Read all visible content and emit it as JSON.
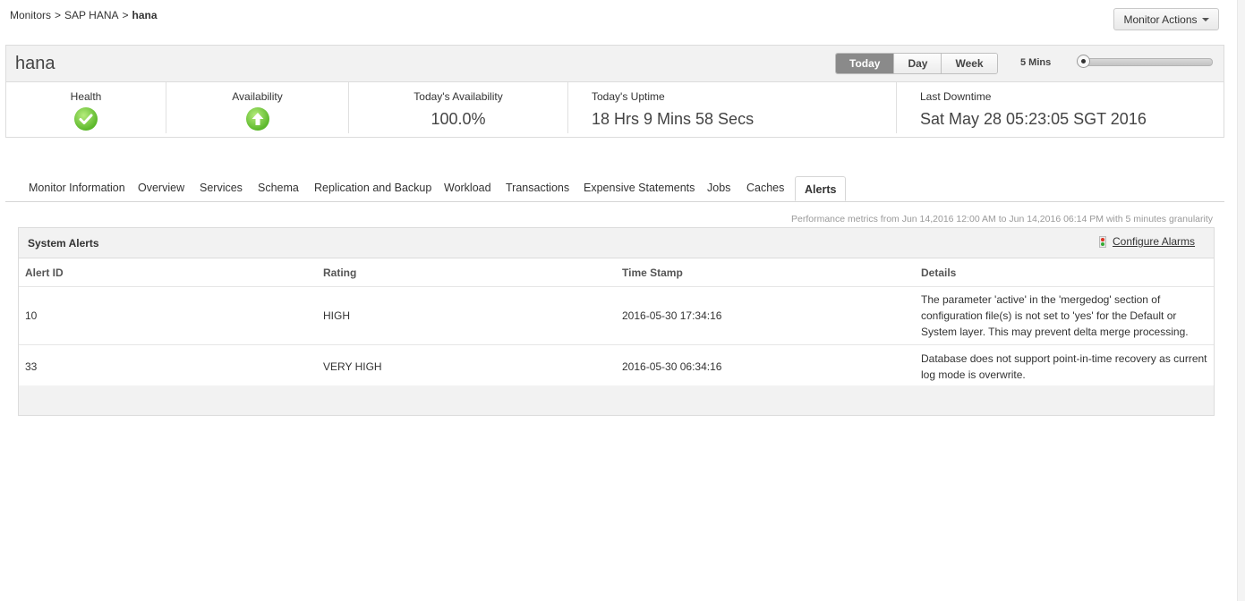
{
  "breadcrumb": {
    "items": [
      "Monitors",
      "SAP HANA"
    ],
    "separator": ">",
    "current": "hana"
  },
  "monitor_actions": {
    "label": "Monitor Actions"
  },
  "header": {
    "monitor_name": "hana",
    "periods": [
      "Today",
      "Day",
      "Week"
    ],
    "active_period": "Today",
    "interval_label": "5 Mins",
    "slider_level": 0
  },
  "stats": {
    "health": {
      "label": "Health",
      "icon": "check-circle-icon",
      "color": "#5cb82b"
    },
    "availability": {
      "label": "Availability",
      "icon": "arrow-up-circle-icon",
      "color": "#5cb82b"
    },
    "todays_availability": {
      "label": "Today's Availability",
      "value": "100.0%"
    },
    "todays_uptime": {
      "label": "Today's Uptime",
      "value": "18 Hrs 9 Mins 58 Secs"
    },
    "last_downtime": {
      "label": "Last Downtime",
      "value": "Sat May 28 05:23:05 SGT 2016"
    }
  },
  "tabs": [
    "Monitor Information",
    "Overview",
    "Services",
    "Schema",
    "Replication and Backup",
    "Workload",
    "Transactions",
    "Expensive Statements",
    "Jobs",
    "Caches",
    "Alerts"
  ],
  "active_tab": "Alerts",
  "perf_note": "Performance metrics from Jun 14,2016 12:00 AM to Jun 14,2016 06:14 PM with 5 minutes granularity",
  "alerts": {
    "title": "System Alerts",
    "configure_label": "Configure Alarms",
    "columns": [
      "Alert ID",
      "Rating",
      "Time Stamp",
      "Details"
    ],
    "rows": [
      {
        "id": "10",
        "rating": "HIGH",
        "timestamp": "2016-05-30 17:34:16",
        "details": "The parameter 'active' in the 'mergedog' section of configuration file(s) is not set to 'yes' for the Default or System layer. This may prevent delta merge processing."
      },
      {
        "id": "33",
        "rating": "VERY HIGH",
        "timestamp": "2016-05-30 06:34:16",
        "details": "Database does not support point-in-time recovery as current log mode is overwrite."
      }
    ]
  }
}
